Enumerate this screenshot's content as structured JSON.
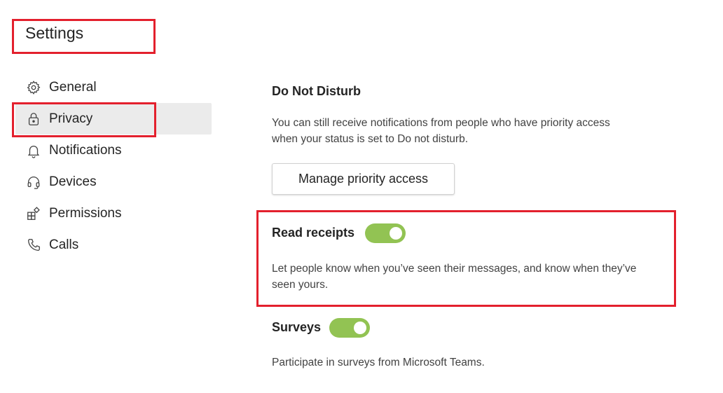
{
  "page": {
    "title": "Settings"
  },
  "sidebar": {
    "items": [
      {
        "label": "General",
        "icon": "gear-icon"
      },
      {
        "label": "Privacy",
        "icon": "lock-icon",
        "selected": true
      },
      {
        "label": "Notifications",
        "icon": "bell-icon"
      },
      {
        "label": "Devices",
        "icon": "headset-icon"
      },
      {
        "label": "Permissions",
        "icon": "apps-icon"
      },
      {
        "label": "Calls",
        "icon": "phone-icon"
      }
    ]
  },
  "main": {
    "dnd": {
      "heading": "Do Not Disturb",
      "description_line1": "You can still receive notifications from people who have priority access",
      "description_line2": "when your status is set to Do not disturb.",
      "button_label": "Manage priority access"
    },
    "read_receipts": {
      "heading": "Read receipts",
      "enabled": true,
      "description_line1": "Let people know when you’ve seen their messages, and know when they’ve",
      "description_line2": "seen yours."
    },
    "surveys": {
      "heading": "Surveys",
      "enabled": true,
      "description": "Participate in surveys from Microsoft Teams."
    }
  },
  "colors": {
    "highlight": "#e3202d",
    "toggle_on": "#92c353",
    "selected_bg": "#ebebeb",
    "text": "#242424"
  }
}
